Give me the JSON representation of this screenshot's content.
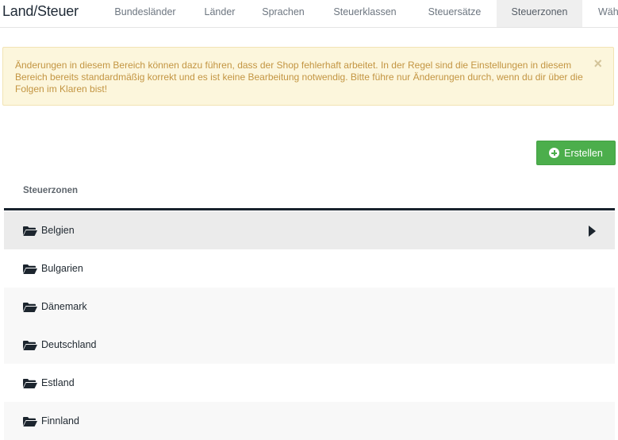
{
  "header": {
    "title": "Land/Steuer",
    "tabs": [
      {
        "label": "Bundesländer"
      },
      {
        "label": "Länder"
      },
      {
        "label": "Sprachen"
      },
      {
        "label": "Steuerklassen"
      },
      {
        "label": "Steuersätze"
      },
      {
        "label": "Steuerzonen",
        "active": true
      },
      {
        "label": "Währ"
      }
    ]
  },
  "alert": {
    "text": "Änderungen in diesem Bereich können dazu führen, dass der Shop fehlerhaft arbeitet. In der Regel sind die Einstellungen in diesem Bereich bereits standardmäßig korrekt und es ist keine Bearbeitung notwendig. Bitte führe nur Änderungen durch, wenn du dir über die Folgen im Klaren bist!",
    "close_symbol": "×"
  },
  "actions": {
    "create_label": "Erstellen",
    "create_icon": "plus-circle-icon"
  },
  "table": {
    "header": "Steuerzonen",
    "rows": [
      {
        "label": "Belgien",
        "icon": "folder-open-icon",
        "selected": true
      },
      {
        "label": "Bulgarien",
        "icon": "folder-open-icon"
      },
      {
        "label": "Dänemark",
        "icon": "folder-open-icon"
      },
      {
        "label": "Deutschland",
        "icon": "folder-open-icon"
      },
      {
        "label": "Estland",
        "icon": "folder-open-icon"
      },
      {
        "label": "Finnland",
        "icon": "folder-open-icon"
      }
    ]
  },
  "colors": {
    "accent_green": "#4cae4c",
    "alert_background": "#fcf6dc",
    "alert_text": "#c39542",
    "table_rule": "#18222d"
  }
}
